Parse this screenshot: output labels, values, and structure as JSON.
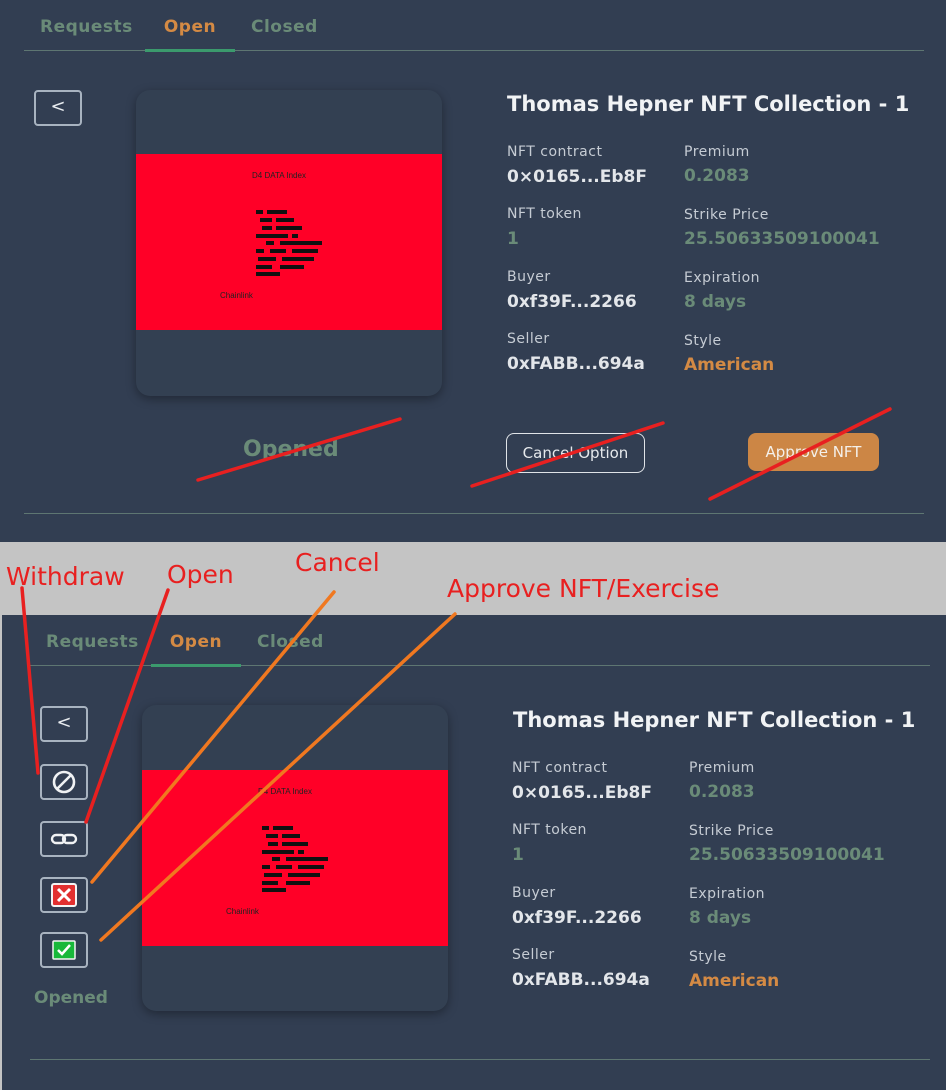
{
  "tabs": [
    "Requests",
    "Open",
    "Closed"
  ],
  "back_label": "<",
  "nft": {
    "image_text_top": "D4 DATA Index",
    "image_text_bottom": "Chainlink",
    "image_bg": "#ff0027"
  },
  "title": "Thomas Hepner NFT Collection - 1",
  "fields": {
    "nft_contract_label": "NFT contract",
    "nft_contract": "0×0165...Eb8F",
    "premium_label": "Premium",
    "premium": "0.2083",
    "nft_token_label": "NFT token",
    "nft_token": "1",
    "strike_label": "Strike Price",
    "strike": "25.50633509100041",
    "buyer_label": "Buyer",
    "buyer": "0xf39F...2266",
    "expiration_label": "Expiration",
    "expiration": "8 days",
    "seller_label": "Seller",
    "seller": "0xFABB...694a",
    "style_label": "Style",
    "style": "American"
  },
  "status": "Opened",
  "cancel_button": "Cancel Option",
  "approve_button": "Approve NFT",
  "annotations": {
    "withdraw": "Withdraw",
    "open": "Open",
    "cancel": "Cancel",
    "approve": "Approve NFT/Exercise"
  },
  "action_icons": [
    "ban-icon",
    "link-icon",
    "close-icon",
    "check-icon"
  ],
  "colors": {
    "panel_bg": "#323e52",
    "accent_orange": "#d48a44",
    "accent_green": "#6a8b78",
    "annotation_red": "#e82020",
    "annotation_orange": "#f07820"
  }
}
